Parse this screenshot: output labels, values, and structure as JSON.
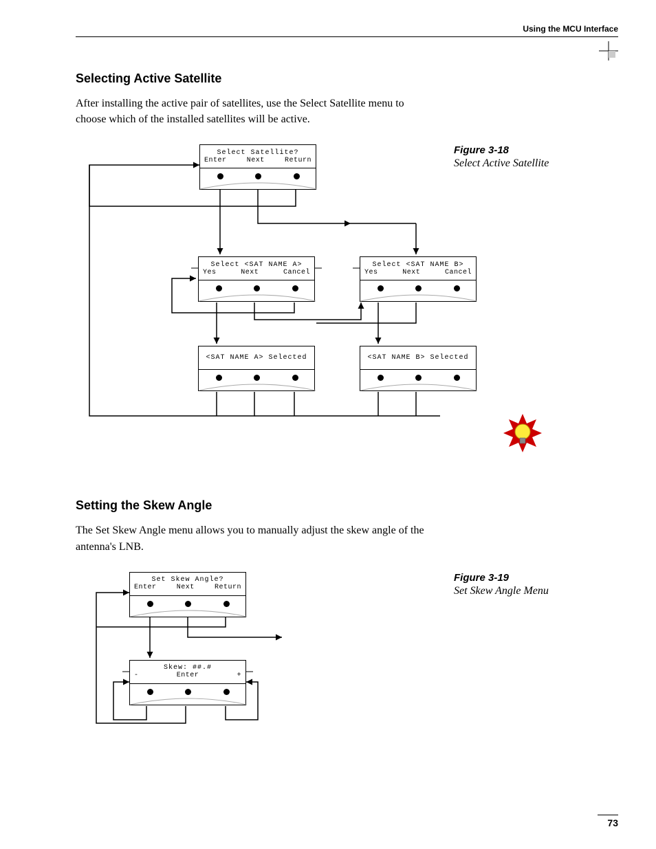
{
  "header": "Using the MCU Interface",
  "pageNumber": "73",
  "section1": {
    "heading": "Selecting Active Satellite",
    "body": "After installing the active pair of satellites, use the Select Satellite menu to choose which of the installed satellites will be active.",
    "figureNo": "Figure 3-18",
    "figureTitle": "Select Active Satellite"
  },
  "section2": {
    "heading": "Setting the Skew Angle",
    "body": "The Set Skew Angle menu allows you to manually adjust the skew angle of the antenna's LNB.",
    "figureNo": "Figure 3-19",
    "figureTitle": "Set Skew Angle Menu"
  },
  "mcu": {
    "selectSat": {
      "l1": "Select Satellite?",
      "a": "Enter",
      "b": "Next",
      "c": "Return"
    },
    "satA": {
      "l1": "Select <SAT NAME A>",
      "a": "Yes",
      "b": "Next",
      "c": "Cancel"
    },
    "satB": {
      "l1": "Select <SAT NAME B>",
      "a": "Yes",
      "b": "Next",
      "c": "Cancel"
    },
    "selA": {
      "l1": "<SAT NAME A> Selected",
      "a": "",
      "b": "",
      "c": ""
    },
    "selB": {
      "l1": "<SAT NAME B> Selected",
      "a": "",
      "b": "",
      "c": ""
    },
    "skew": {
      "l1": "Set Skew Angle?",
      "a": "Enter",
      "b": "Next",
      "c": "Return"
    },
    "skewVal": {
      "l1": "Skew: ##.#",
      "a": "-",
      "b": "Enter",
      "c": "+"
    }
  }
}
